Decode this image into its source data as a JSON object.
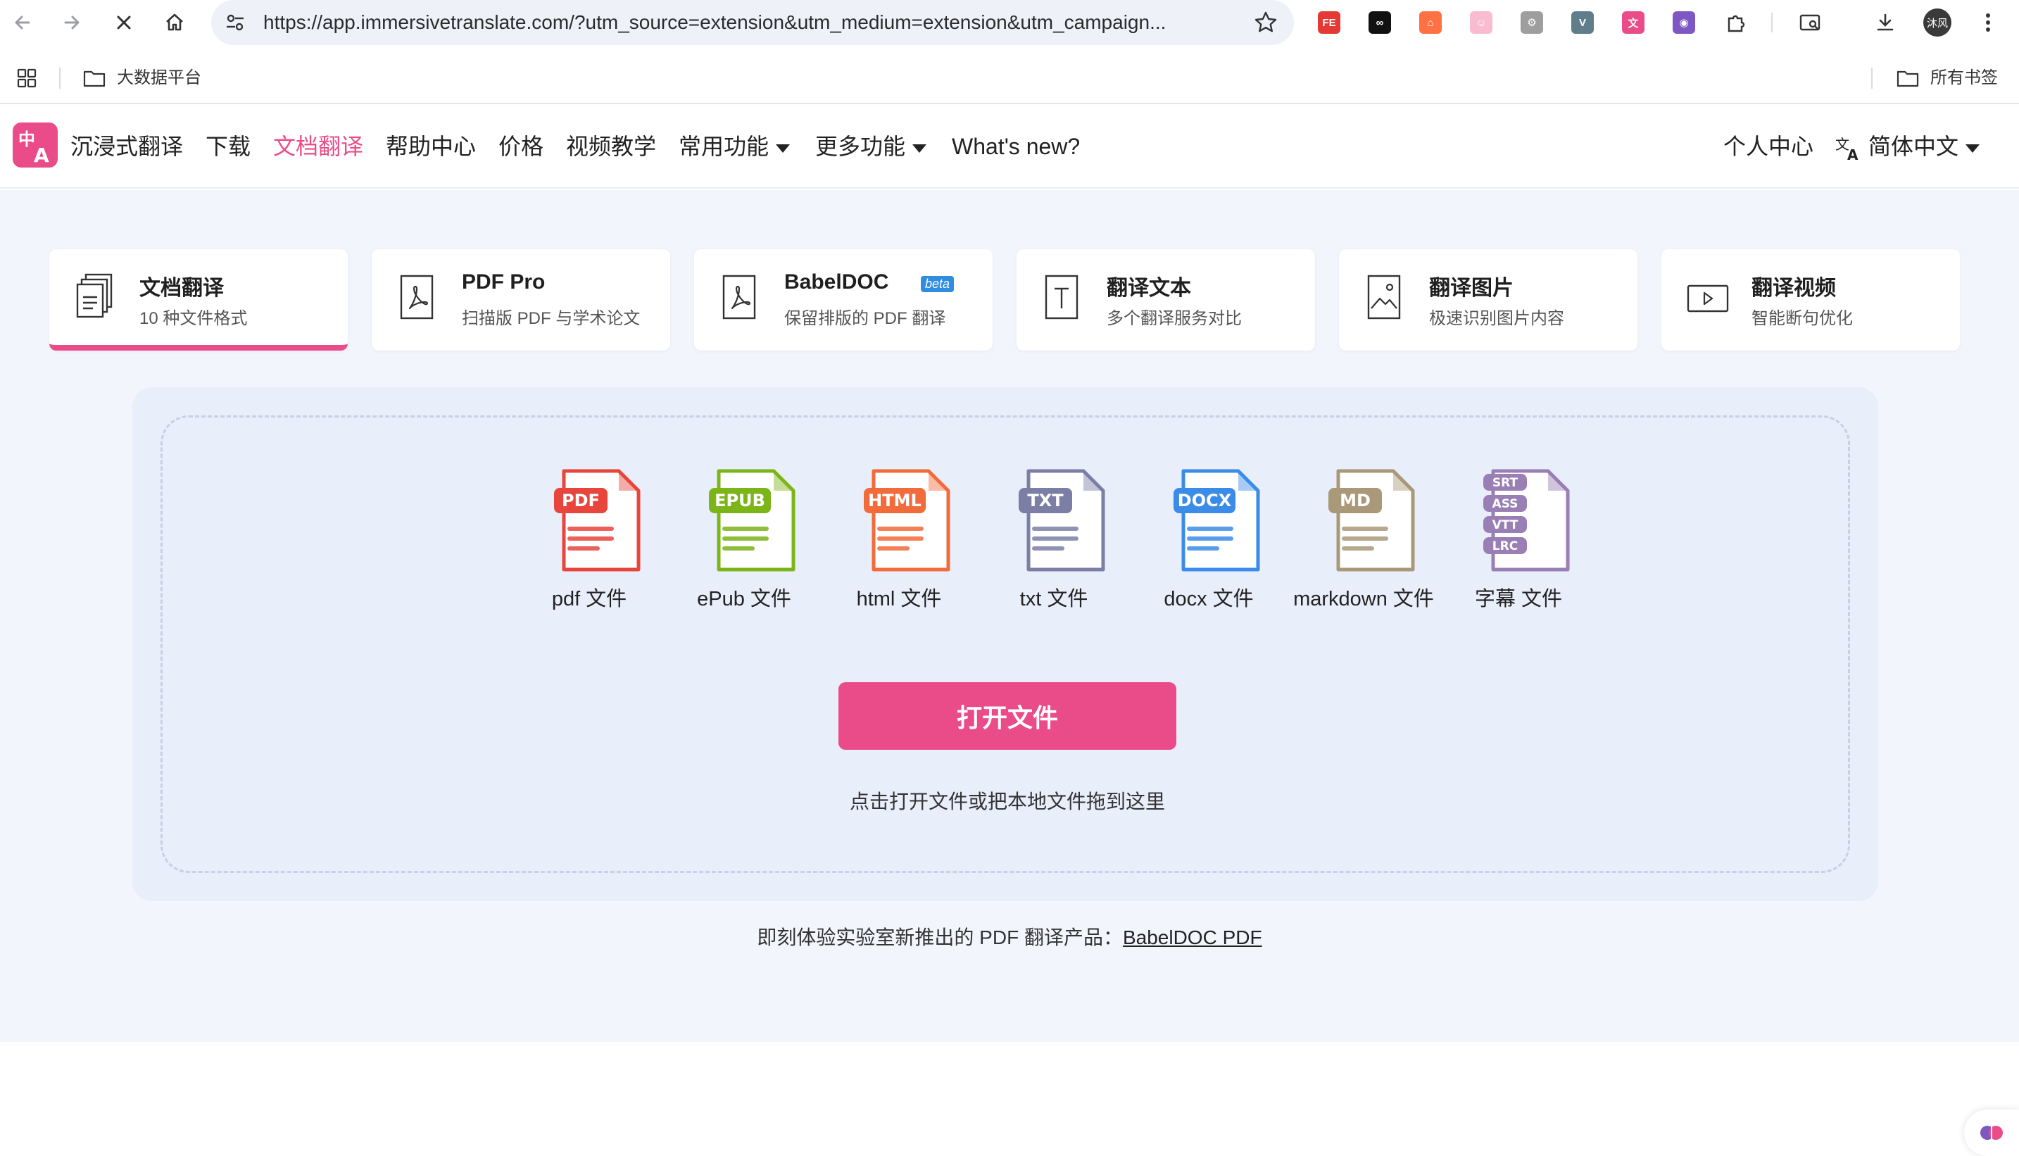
{
  "browser": {
    "url": "https://app.immersivetranslate.com/?utm_source=extension&utm_medium=extension&utm_campaign...",
    "extensions": [
      {
        "name": "fe-helper-icon",
        "label": "FE",
        "color": "#e53935"
      },
      {
        "name": "infinity-icon",
        "label": "∞",
        "color": "#111111"
      },
      {
        "name": "hierarchy-icon",
        "label": "⌂",
        "color": "#ff7043"
      },
      {
        "name": "cat-icon",
        "label": "☺",
        "color": "#f8bbd0"
      },
      {
        "name": "gear-extension-icon",
        "label": "⚙",
        "color": "#9e9e9e"
      },
      {
        "name": "vue-icon",
        "label": "V",
        "color": "#607d8b"
      },
      {
        "name": "translate-extension-icon",
        "label": "文",
        "color": "#ea4c89"
      },
      {
        "name": "brain-icon",
        "label": "◉",
        "color": "#7e57c2"
      }
    ],
    "avatar_label": "沐风",
    "bookmarks": {
      "folder": "大数据平台",
      "all": "所有书签"
    }
  },
  "header": {
    "brand": "沉浸式翻译",
    "nav": {
      "download": "下载",
      "doc": "文档翻译",
      "help": "帮助中心",
      "price": "价格",
      "video": "视频教学",
      "common": "常用功能",
      "more": "更多功能",
      "whatsnew": "What's new?"
    },
    "account": "个人中心",
    "language": "简体中文"
  },
  "tabs": [
    {
      "title": "文档翻译",
      "sub": "10 种文件格式"
    },
    {
      "title": "PDF Pro",
      "sub": "扫描版 PDF 与学术论文"
    },
    {
      "title": "BabelDOC",
      "sub": "保留排版的 PDF 翻译",
      "badge": "beta"
    },
    {
      "title": "翻译文本",
      "sub": "多个翻译服务对比"
    },
    {
      "title": "翻译图片",
      "sub": "极速识别图片内容"
    },
    {
      "title": "翻译视频",
      "sub": "智能断句优化"
    }
  ],
  "formats": [
    {
      "label": "pdf 文件",
      "badge": "PDF",
      "color": "#e8453c"
    },
    {
      "label": "ePub 文件",
      "badge": "EPUB",
      "color": "#7cb518"
    },
    {
      "label": "html 文件",
      "badge": "HTML",
      "color": "#f26b3a"
    },
    {
      "label": "txt 文件",
      "badge": "TXT",
      "color": "#7b7fa6"
    },
    {
      "label": "docx 文件",
      "badge": "DOCX",
      "color": "#3b8ce8"
    },
    {
      "label": "markdown 文件",
      "badge": "MD",
      "color": "#a99978"
    },
    {
      "label": "字幕 文件",
      "badges": [
        "SRT",
        "ASS",
        "VTT",
        "LRC"
      ],
      "color": "#9a7fb5"
    }
  ],
  "upload": {
    "button": "打开文件",
    "hint": "点击打开文件或把本地文件拖到这里"
  },
  "promo": {
    "text": "即刻体验实验室新推出的 PDF 翻译产品：",
    "link": "BabelDOC PDF"
  },
  "colors": {
    "accent": "#ea4c89",
    "band": "#f3f5fd",
    "panel": "#e9eefb"
  }
}
